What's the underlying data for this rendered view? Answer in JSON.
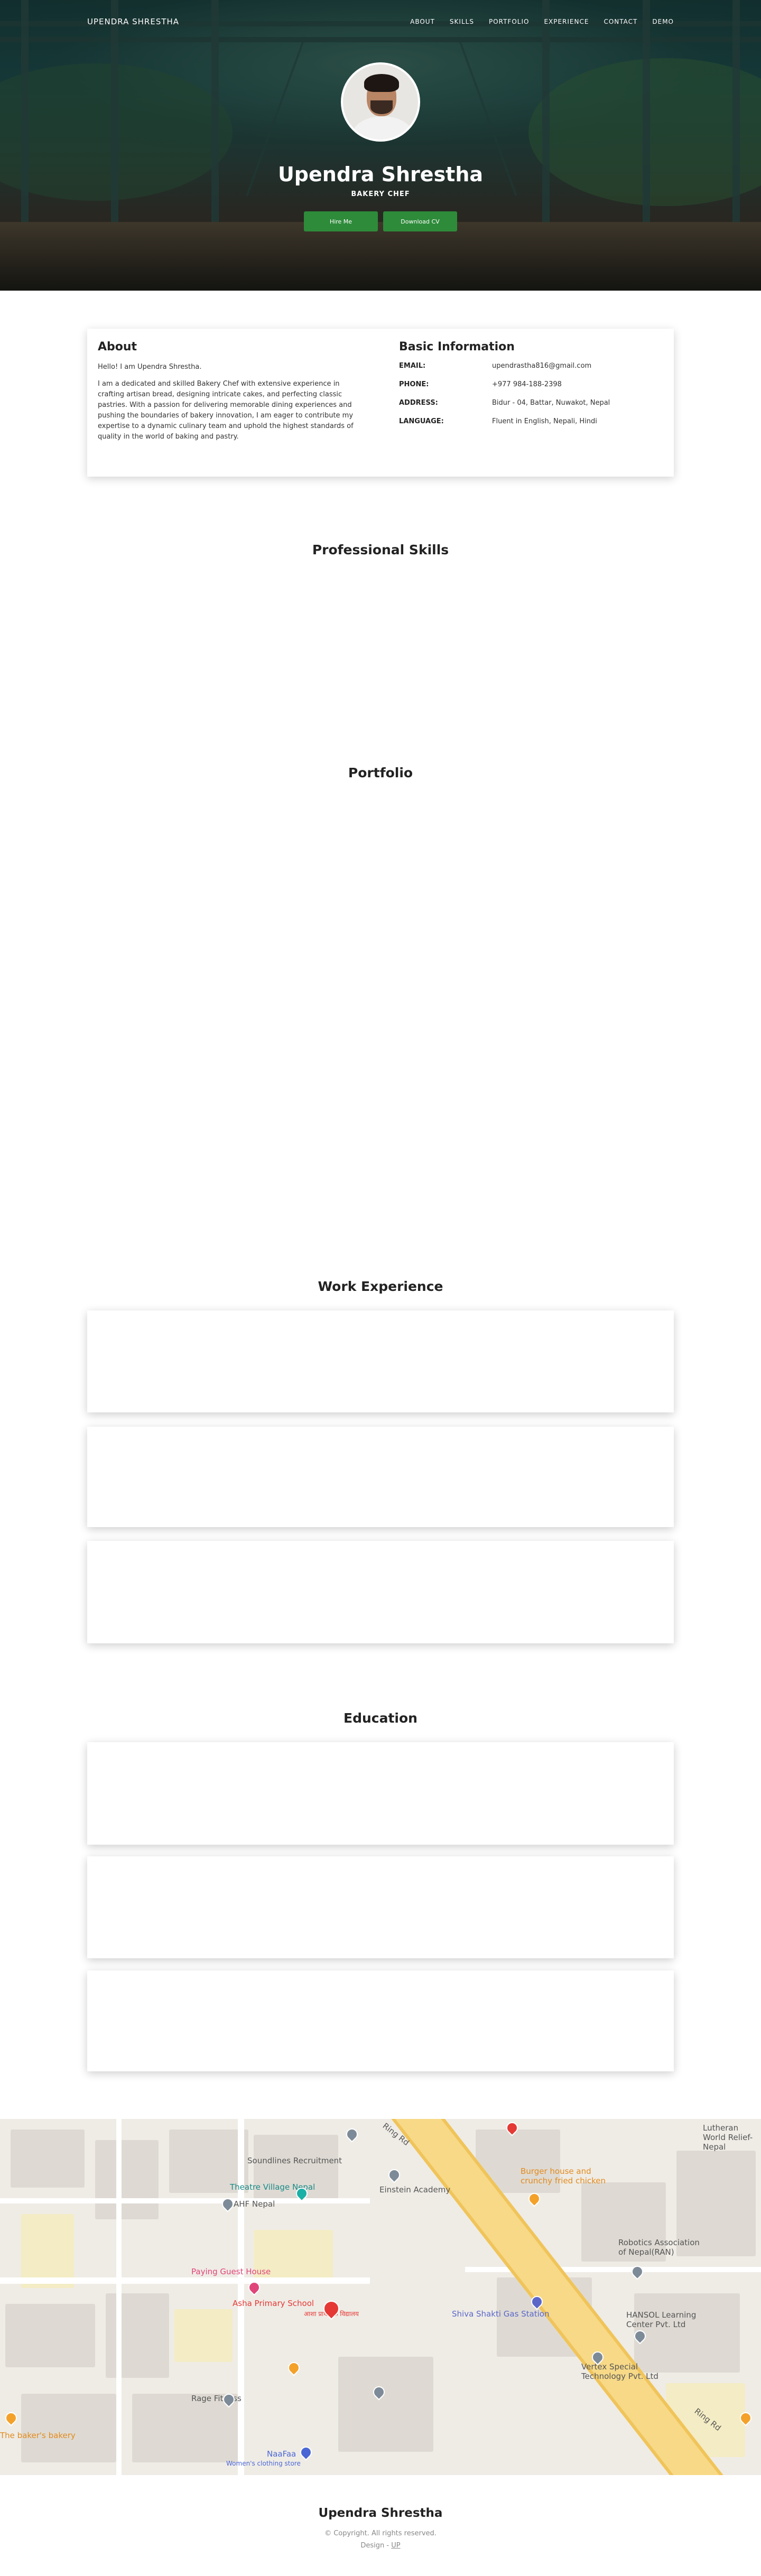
{
  "nav": {
    "brand": "UPENDRA SHRESTHA",
    "items": [
      "ABOUT",
      "SKILLS",
      "PORTFOLIO",
      "EXPERIENCE",
      "CONTACT",
      "DEMO"
    ]
  },
  "hero": {
    "name": "Upendra Shrestha",
    "title": "BAKERY CHEF",
    "hire_label": "Hire Me",
    "download_label": "Download CV"
  },
  "about": {
    "heading": "About",
    "greeting": "Hello! I am Upendra Shrestha.",
    "bio": "I am a dedicated and skilled Bakery Chef with extensive experience in crafting artisan bread, designing intricate cakes, and perfecting classic pastries. With a passion for delivering memorable dining experiences and pushing the boundaries of bakery innovation, I am eager to contribute my expertise to a dynamic culinary team and uphold the highest standards of quality in the world of baking and pastry."
  },
  "basic": {
    "heading": "Basic Information",
    "rows": [
      {
        "key": "EMAIL:",
        "value": "upendrastha816@gmail.com"
      },
      {
        "key": "PHONE:",
        "value": "+977 984-188-2398"
      },
      {
        "key": "ADDRESS:",
        "value": "Bidur - 04, Battar, Nuwakot, Nepal"
      },
      {
        "key": "LANGUAGE:",
        "value": "Fluent in English, Nepali, Hindi"
      }
    ]
  },
  "sections": {
    "skills": "Professional Skills",
    "portfolio": "Portfolio",
    "experience": "Work Experience",
    "education": "Education"
  },
  "map": {
    "labels": {
      "soundlines": "Soundlines Recruitment",
      "theatre": "Theatre Village Nepal",
      "ahf": "AHF Nepal",
      "einstein": "Einstein Academy",
      "burger": "Burger house and crunchy fried chicken",
      "robotics": "Robotics Association of Nepal(RAN)",
      "paying": "Paying Guest House",
      "asha": "Asha Primary School",
      "asha_sub": "आशा प्राथमिक विद्यालय",
      "shiva": "Shiva Shakti Gas Station",
      "hansol": "HANSOL Learning Center Pvt. Ltd",
      "vertex": "Vertex Special Technology Pvt. Ltd",
      "rage": "Rage Fitness",
      "lutheran": "Lutheran World Relief- Nepal",
      "naafaa": "NaaFaa",
      "naafaa_sub": "Women's clothing store",
      "bakery": "The baker's bakery",
      "ringrd": "Ring Rd"
    }
  },
  "footer": {
    "name": "Upendra Shrestha",
    "copy": "© Copyright. All rights reserved.",
    "design_prefix": "Design - ",
    "design_link": "UP"
  },
  "colors": {
    "accent_green": "#2e8b3a",
    "map_pin_red": "#e53935"
  }
}
